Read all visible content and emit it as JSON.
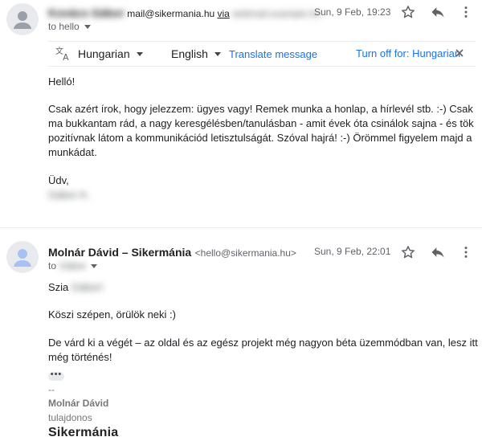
{
  "message1": {
    "sender_name_blurred": "Kovács Gábor",
    "sender_email": "mail@sikermania.hu",
    "via_label": "via",
    "via_blurred": "webmail.example.hu",
    "date": "Sun, 9 Feb, 19:23",
    "to_label": "to hello",
    "translate": {
      "source_lang": "Hungarian",
      "target_lang": "English",
      "translate_link": "Translate message",
      "turn_off_link": "Turn off for: Hungarian"
    },
    "body": {
      "greeting": "Helló!",
      "paragraph": "Csak azért írok, hogy jelezzem: ügyes vagy! Remek munka a honlap, a hírlevél stb. :-) Csak ma bukkantam rád, a nagy keresgélésben/tanulásban - amit évek óta csinálok sajna - és tök pozitívnak látom a kommunikációd letisztulságát. Szóval hajrá! :-) Örömmel figyelem majd a munkádat.",
      "closing": "Üdv,",
      "signature_blurred": "Gábor K."
    }
  },
  "message2": {
    "sender_name": "Molnár Dávid – Sikermánia",
    "sender_email": "<hello@sikermania.hu>",
    "date": "Sun, 9 Feb, 22:01",
    "to_prefix": "to",
    "to_blurred": "Gábor",
    "body": {
      "greeting": "Szia",
      "greeting_name_blurred": "Gábor!",
      "line1": "Köszi szépen, örülök neki :)",
      "line2": "De várd ki a végét – az oldal és az egész projekt még nagyon béta üzemmódban van, lesz itt még történés!",
      "ellipsis": "•••"
    },
    "signature": {
      "dashes": "--",
      "name": "Molnár Dávid",
      "title": "tulajdonos",
      "logo": "Sikermánia"
    }
  },
  "icons": [
    "avatar-icon",
    "star-icon",
    "reply-icon",
    "more-vert-icon",
    "translate-icon",
    "close-icon",
    "chevron-down-icon"
  ]
}
